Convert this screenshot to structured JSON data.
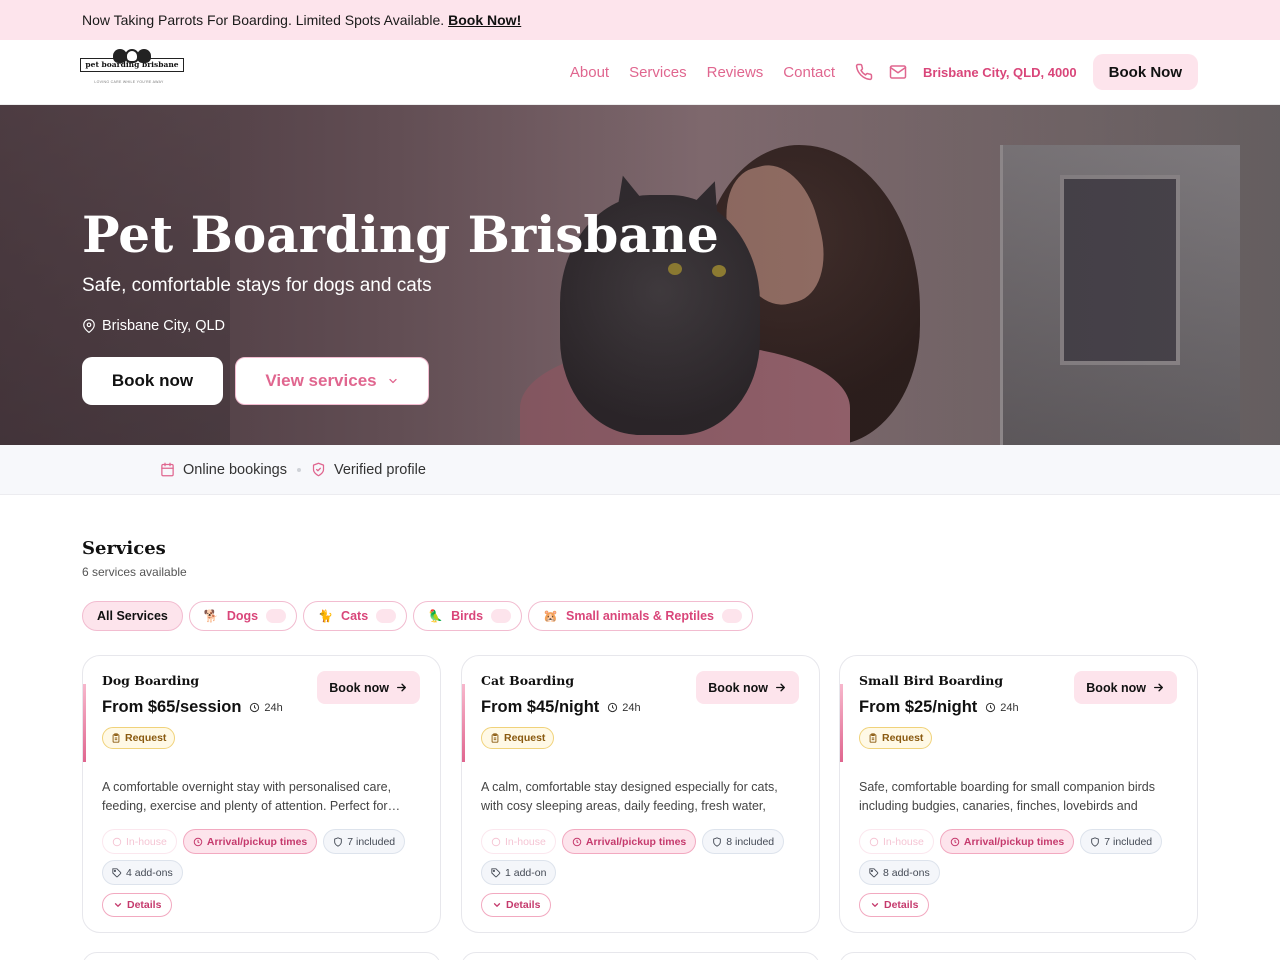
{
  "announcement": {
    "text": "Now Taking Parrots For Boarding. Limited Spots Available.",
    "link": "Book Now!"
  },
  "header": {
    "logo_text": "pet boarding brisbane",
    "logo_tagline": "LOVING CARE WHILE YOU'RE AWAY",
    "nav": [
      "About",
      "Services",
      "Reviews",
      "Contact"
    ],
    "location": "Brisbane City, QLD, 4000",
    "book_label": "Book Now"
  },
  "hero": {
    "title": "Pet Boarding Brisbane",
    "subtitle": "Safe, comfortable stays for dogs and cats",
    "location": "Brisbane City, QLD",
    "book_label": "Book now",
    "services_label": "View services"
  },
  "trust": {
    "online": "Online bookings",
    "verified": "Verified profile"
  },
  "services": {
    "title": "Services",
    "count": "6 services available",
    "filters": [
      {
        "label": "All Services",
        "emoji": ""
      },
      {
        "label": "Dogs",
        "emoji": "🐕"
      },
      {
        "label": "Cats",
        "emoji": "🐈"
      },
      {
        "label": "Birds",
        "emoji": "🦜"
      },
      {
        "label": "Small animals & Reptiles",
        "emoji": "🐹"
      }
    ],
    "cards": [
      {
        "name": "Dog Boarding",
        "price": "From $65/session",
        "duration": "24h",
        "book": "Book now",
        "request": "Request",
        "description": "A comfortable overnight stay with personalised care, feeding, exercise and plenty of attention. Perfect for…",
        "in_house": "In-house",
        "arrival": "Arrival/pickup times",
        "included": "7 included",
        "addons": "4 add-ons",
        "details": "Details"
      },
      {
        "name": "Cat Boarding",
        "price": "From $45/night",
        "duration": "24h",
        "book": "Book now",
        "request": "Request",
        "description": "A calm, comfortable stay designed especially for cats, with cosy sleeping areas, daily feeding, fresh water, litte…",
        "in_house": "In-house",
        "arrival": "Arrival/pickup times",
        "included": "8 included",
        "addons": "1 add-on",
        "details": "Details"
      },
      {
        "name": "Small Bird Boarding",
        "price": "From $25/night",
        "duration": "24h",
        "book": "Book now",
        "request": "Request",
        "description": "Safe, comfortable boarding for small companion birds including budgies, canaries, finches, lovebirds and small…",
        "in_house": "In-house",
        "arrival": "Arrival/pickup times",
        "included": "7 included",
        "addons": "8 add-ons",
        "details": "Details"
      }
    ]
  },
  "colors": {
    "accent": "#e0668f",
    "accent_light": "#fde4ec",
    "request_bg": "#fff9e6"
  }
}
